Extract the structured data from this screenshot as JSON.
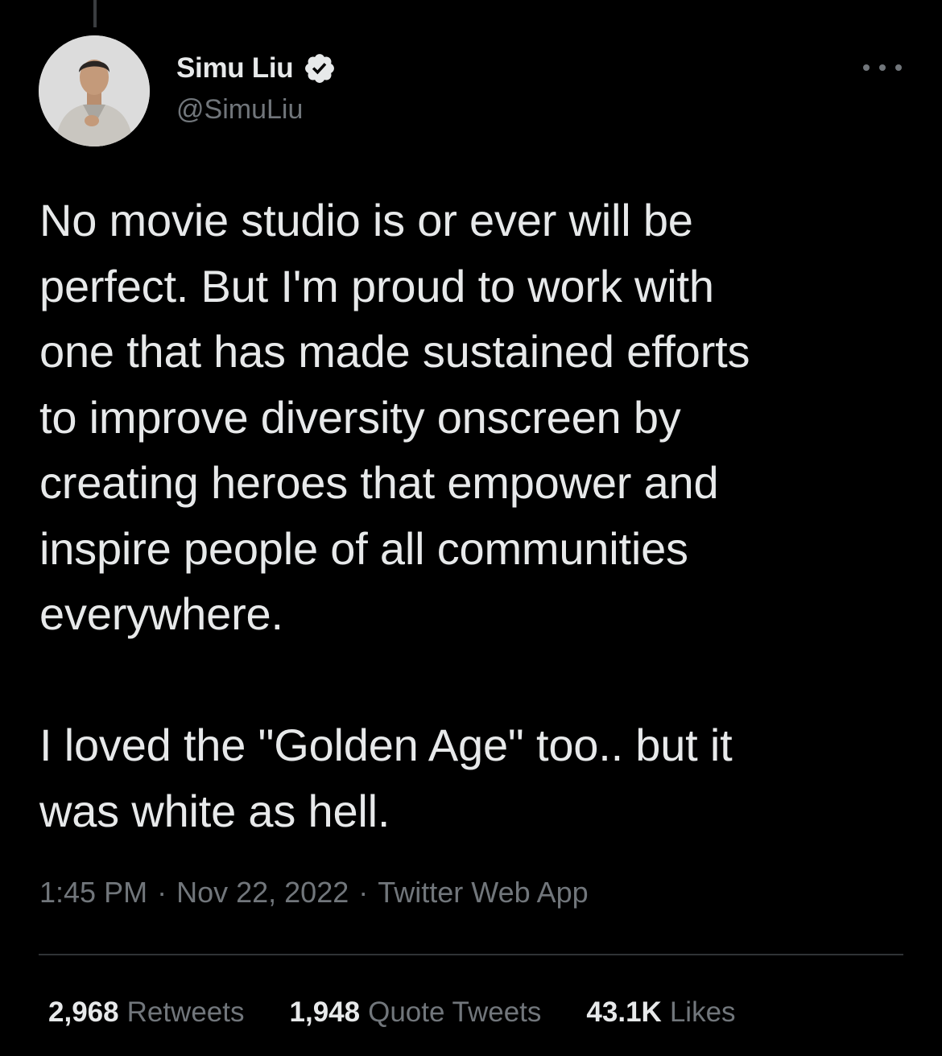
{
  "tweet": {
    "author": {
      "display_name": "Simu Liu",
      "handle": "@SimuLiu",
      "verified": true,
      "avatar_icon": "profile-photo"
    },
    "more_icon": "more-options-icon",
    "text": "No movie studio is or ever will be\nperfect. But I'm proud to work with\none that has made sustained efforts\nto improve diversity onscreen by\ncreating heroes that empower and\ninspire people of all communities\neverywhere.\n\nI loved the \"Golden Age\" too.. but it\nwas white as hell.",
    "meta": {
      "time": "1:45 PM",
      "separator": "·",
      "date": "Nov 22, 2022",
      "source": "Twitter Web App"
    },
    "stats": [
      {
        "count": "2,968",
        "label": "Retweets"
      },
      {
        "count": "1,948",
        "label": "Quote Tweets"
      },
      {
        "count": "43.1K",
        "label": "Likes"
      }
    ]
  },
  "colors": {
    "background": "#000000",
    "primary_text": "#e7e9ea",
    "secondary_text": "#71767b",
    "divider": "#2f3336"
  }
}
